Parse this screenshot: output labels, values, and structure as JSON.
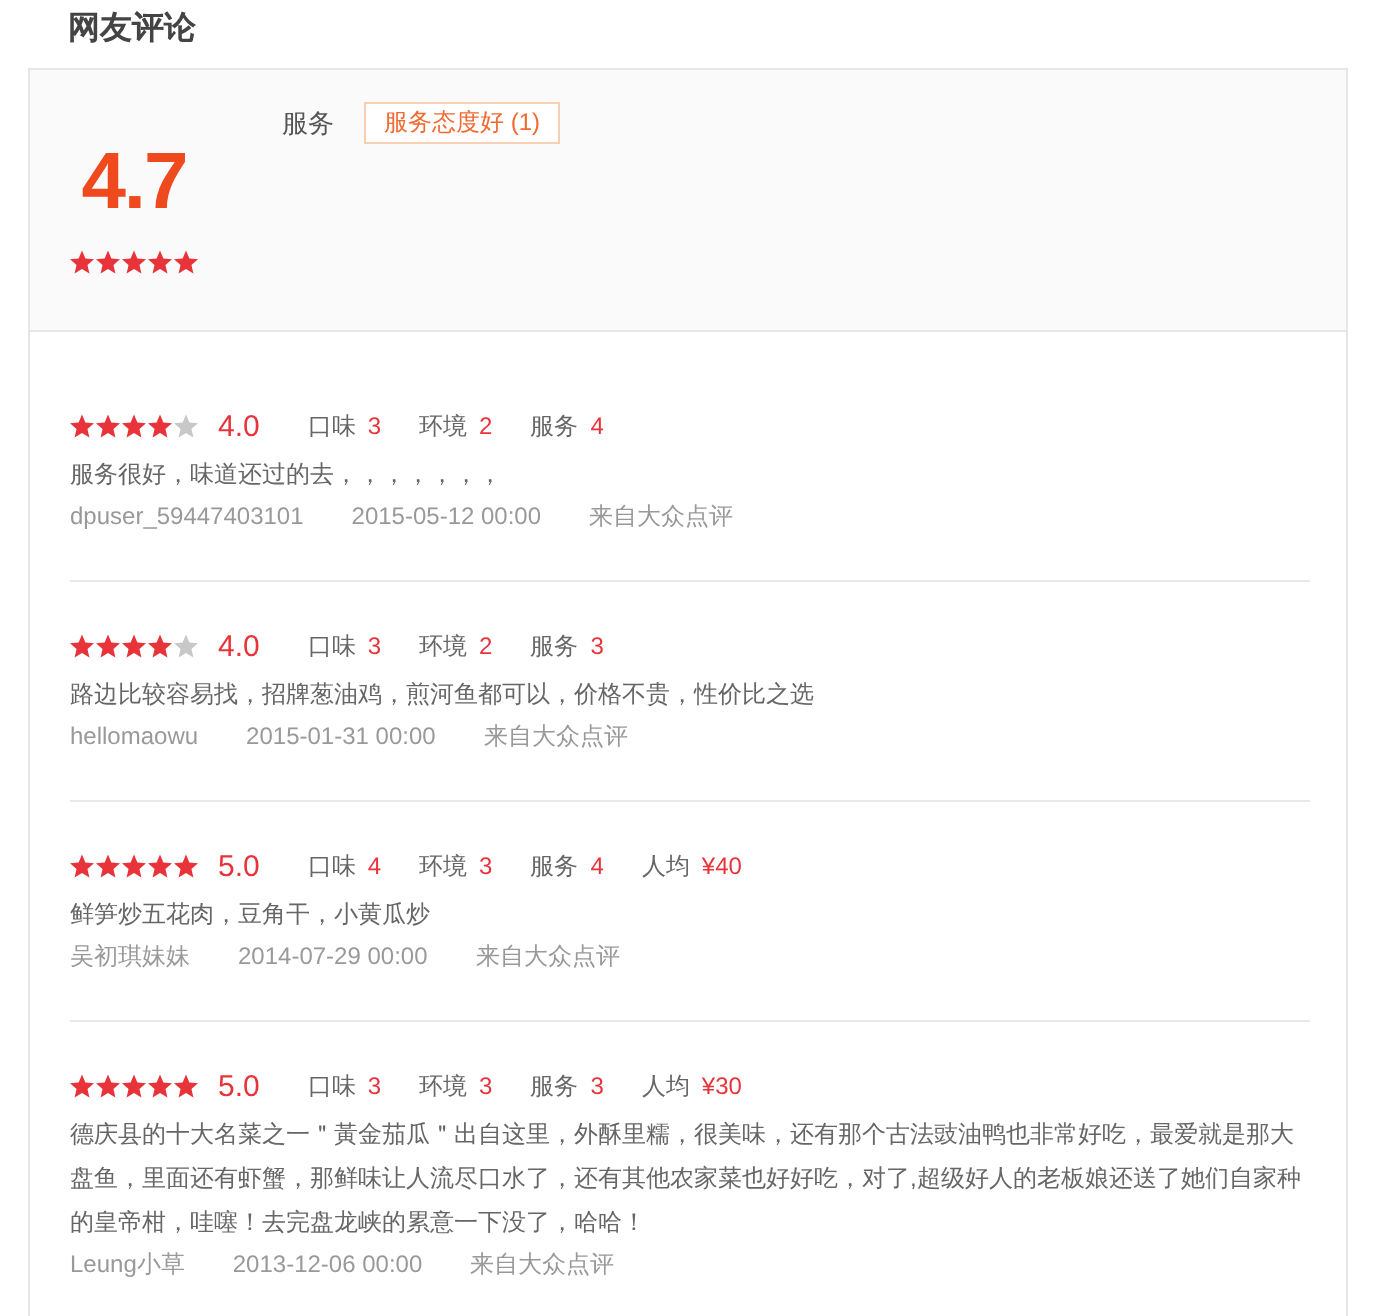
{
  "section": {
    "title": "网友评论"
  },
  "summary": {
    "score": "4.7",
    "stars": 5,
    "tag_groups": [
      {
        "label": "服务",
        "tags": [
          {
            "label": "服务态度好 (1)"
          }
        ]
      }
    ]
  },
  "reviews": [
    {
      "stars": 4,
      "score": "4.0",
      "ratings": [
        {
          "label": "口味",
          "value": "3"
        },
        {
          "label": "环境",
          "value": "2"
        },
        {
          "label": "服务",
          "value": "4"
        }
      ],
      "content": "服务很好，味道还过的去，，，，，，，",
      "user": "dpuser_59447403101",
      "date": "2015-05-12 00:00",
      "source": "来自大众点评"
    },
    {
      "stars": 4,
      "score": "4.0",
      "ratings": [
        {
          "label": "口味",
          "value": "3"
        },
        {
          "label": "环境",
          "value": "2"
        },
        {
          "label": "服务",
          "value": "3"
        }
      ],
      "content": "路边比较容易找，招牌葱油鸡，煎河鱼都可以，价格不贵，性价比之选",
      "user": "hellomaowu",
      "date": "2015-01-31 00:00",
      "source": "来自大众点评"
    },
    {
      "stars": 5,
      "score": "5.0",
      "ratings": [
        {
          "label": "口味",
          "value": "4"
        },
        {
          "label": "环境",
          "value": "3"
        },
        {
          "label": "服务",
          "value": "4"
        },
        {
          "label": "人均",
          "value": "¥40"
        }
      ],
      "content": "鲜笋炒五花肉，豆角干，小黄瓜炒",
      "user": "吴初琪妹妹",
      "date": "2014-07-29 00:00",
      "source": "来自大众点评"
    },
    {
      "stars": 5,
      "score": "5.0",
      "ratings": [
        {
          "label": "口味",
          "value": "3"
        },
        {
          "label": "环境",
          "value": "3"
        },
        {
          "label": "服务",
          "value": "3"
        },
        {
          "label": "人均",
          "value": "¥30"
        }
      ],
      "content": "德庆县的十大名菜之一＂黃金茄瓜＂出自这里，外酥里糯，很美味，还有那个古法豉油鸭也非常好吃，最爱就是那大盘鱼，里面还有虾蟹，那鲜味让人流尽口水了，还有其他农家菜也好好吃，对了,超级好人的老板娘还送了她们自家种的皇帝柑，哇噻！去完盘龙峡的累意一下没了，哈哈！",
      "user": "Leung小草",
      "date": "2013-12-06 00:00",
      "source": "来自大众点评"
    }
  ]
}
